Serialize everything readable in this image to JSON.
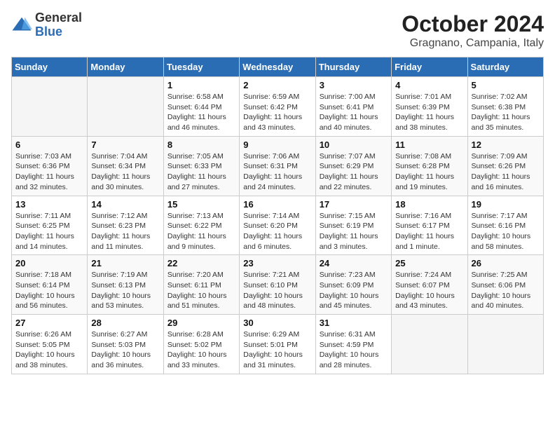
{
  "logo": {
    "line1": "General",
    "line2": "Blue"
  },
  "title": "October 2024",
  "subtitle": "Gragnano, Campania, Italy",
  "weekdays": [
    "Sunday",
    "Monday",
    "Tuesday",
    "Wednesday",
    "Thursday",
    "Friday",
    "Saturday"
  ],
  "weeks": [
    [
      {
        "day": "",
        "info": ""
      },
      {
        "day": "",
        "info": ""
      },
      {
        "day": "1",
        "info": "Sunrise: 6:58 AM\nSunset: 6:44 PM\nDaylight: 11 hours and 46 minutes."
      },
      {
        "day": "2",
        "info": "Sunrise: 6:59 AM\nSunset: 6:42 PM\nDaylight: 11 hours and 43 minutes."
      },
      {
        "day": "3",
        "info": "Sunrise: 7:00 AM\nSunset: 6:41 PM\nDaylight: 11 hours and 40 minutes."
      },
      {
        "day": "4",
        "info": "Sunrise: 7:01 AM\nSunset: 6:39 PM\nDaylight: 11 hours and 38 minutes."
      },
      {
        "day": "5",
        "info": "Sunrise: 7:02 AM\nSunset: 6:38 PM\nDaylight: 11 hours and 35 minutes."
      }
    ],
    [
      {
        "day": "6",
        "info": "Sunrise: 7:03 AM\nSunset: 6:36 PM\nDaylight: 11 hours and 32 minutes."
      },
      {
        "day": "7",
        "info": "Sunrise: 7:04 AM\nSunset: 6:34 PM\nDaylight: 11 hours and 30 minutes."
      },
      {
        "day": "8",
        "info": "Sunrise: 7:05 AM\nSunset: 6:33 PM\nDaylight: 11 hours and 27 minutes."
      },
      {
        "day": "9",
        "info": "Sunrise: 7:06 AM\nSunset: 6:31 PM\nDaylight: 11 hours and 24 minutes."
      },
      {
        "day": "10",
        "info": "Sunrise: 7:07 AM\nSunset: 6:29 PM\nDaylight: 11 hours and 22 minutes."
      },
      {
        "day": "11",
        "info": "Sunrise: 7:08 AM\nSunset: 6:28 PM\nDaylight: 11 hours and 19 minutes."
      },
      {
        "day": "12",
        "info": "Sunrise: 7:09 AM\nSunset: 6:26 PM\nDaylight: 11 hours and 16 minutes."
      }
    ],
    [
      {
        "day": "13",
        "info": "Sunrise: 7:11 AM\nSunset: 6:25 PM\nDaylight: 11 hours and 14 minutes."
      },
      {
        "day": "14",
        "info": "Sunrise: 7:12 AM\nSunset: 6:23 PM\nDaylight: 11 hours and 11 minutes."
      },
      {
        "day": "15",
        "info": "Sunrise: 7:13 AM\nSunset: 6:22 PM\nDaylight: 11 hours and 9 minutes."
      },
      {
        "day": "16",
        "info": "Sunrise: 7:14 AM\nSunset: 6:20 PM\nDaylight: 11 hours and 6 minutes."
      },
      {
        "day": "17",
        "info": "Sunrise: 7:15 AM\nSunset: 6:19 PM\nDaylight: 11 hours and 3 minutes."
      },
      {
        "day": "18",
        "info": "Sunrise: 7:16 AM\nSunset: 6:17 PM\nDaylight: 11 hours and 1 minute."
      },
      {
        "day": "19",
        "info": "Sunrise: 7:17 AM\nSunset: 6:16 PM\nDaylight: 10 hours and 58 minutes."
      }
    ],
    [
      {
        "day": "20",
        "info": "Sunrise: 7:18 AM\nSunset: 6:14 PM\nDaylight: 10 hours and 56 minutes."
      },
      {
        "day": "21",
        "info": "Sunrise: 7:19 AM\nSunset: 6:13 PM\nDaylight: 10 hours and 53 minutes."
      },
      {
        "day": "22",
        "info": "Sunrise: 7:20 AM\nSunset: 6:11 PM\nDaylight: 10 hours and 51 minutes."
      },
      {
        "day": "23",
        "info": "Sunrise: 7:21 AM\nSunset: 6:10 PM\nDaylight: 10 hours and 48 minutes."
      },
      {
        "day": "24",
        "info": "Sunrise: 7:23 AM\nSunset: 6:09 PM\nDaylight: 10 hours and 45 minutes."
      },
      {
        "day": "25",
        "info": "Sunrise: 7:24 AM\nSunset: 6:07 PM\nDaylight: 10 hours and 43 minutes."
      },
      {
        "day": "26",
        "info": "Sunrise: 7:25 AM\nSunset: 6:06 PM\nDaylight: 10 hours and 40 minutes."
      }
    ],
    [
      {
        "day": "27",
        "info": "Sunrise: 6:26 AM\nSunset: 5:05 PM\nDaylight: 10 hours and 38 minutes."
      },
      {
        "day": "28",
        "info": "Sunrise: 6:27 AM\nSunset: 5:03 PM\nDaylight: 10 hours and 36 minutes."
      },
      {
        "day": "29",
        "info": "Sunrise: 6:28 AM\nSunset: 5:02 PM\nDaylight: 10 hours and 33 minutes."
      },
      {
        "day": "30",
        "info": "Sunrise: 6:29 AM\nSunset: 5:01 PM\nDaylight: 10 hours and 31 minutes."
      },
      {
        "day": "31",
        "info": "Sunrise: 6:31 AM\nSunset: 4:59 PM\nDaylight: 10 hours and 28 minutes."
      },
      {
        "day": "",
        "info": ""
      },
      {
        "day": "",
        "info": ""
      }
    ]
  ]
}
